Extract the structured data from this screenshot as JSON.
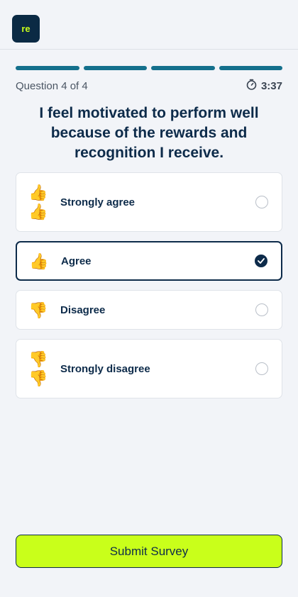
{
  "header": {
    "logo_text": "re"
  },
  "progress": {
    "total_steps": 4,
    "completed_steps": 4,
    "color": "#14708c"
  },
  "meta": {
    "question_count": "Question 4 of 4",
    "timer": "3:37"
  },
  "question": {
    "text": "I feel motivated to perform well because of the rewards and recognition I receive."
  },
  "options": [
    {
      "label": "Strongly agree",
      "emoji": [
        "👍",
        "👍"
      ],
      "selected": false
    },
    {
      "label": "Agree",
      "emoji": [
        "👍"
      ],
      "selected": true
    },
    {
      "label": "Disagree",
      "emoji": [
        "👎"
      ],
      "selected": false
    },
    {
      "label": "Strongly disagree",
      "emoji": [
        "👎",
        "👎"
      ],
      "selected": false
    }
  ],
  "submit": {
    "label": "Submit Survey"
  },
  "colors": {
    "accent": "#c9ff1a",
    "navy": "#0d2b4a",
    "teal": "#14708c"
  }
}
